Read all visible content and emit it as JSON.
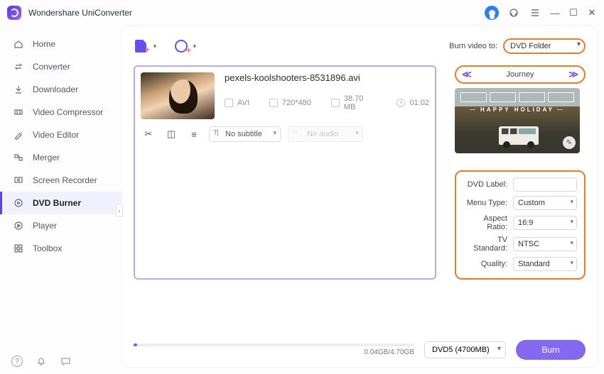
{
  "app": {
    "title": "Wondershare UniConverter"
  },
  "sidebar": {
    "items": [
      {
        "label": "Home"
      },
      {
        "label": "Converter"
      },
      {
        "label": "Downloader"
      },
      {
        "label": "Video Compressor"
      },
      {
        "label": "Video Editor"
      },
      {
        "label": "Merger"
      },
      {
        "label": "Screen Recorder"
      },
      {
        "label": "DVD Burner"
      },
      {
        "label": "Player"
      },
      {
        "label": "Toolbox"
      }
    ],
    "active_index": 7
  },
  "toolbar": {
    "burn_to_label": "Burn video to:",
    "burn_to_value": "DVD Folder"
  },
  "file": {
    "name": "pexels-koolshooters-8531896.avi",
    "format": "AVI",
    "resolution": "720*480",
    "size": "38.70 MB",
    "duration": "01:02",
    "subtitle": "No subtitle",
    "audio": "No audio"
  },
  "template": {
    "name": "Journey",
    "caption": "HAPPY HOLIDAY"
  },
  "settings": {
    "labels": {
      "dvd_label": "DVD Label:",
      "menu_type": "Menu Type:",
      "aspect_ratio": "Aspect Ratio:",
      "tv_standard": "TV Standard:",
      "quality": "Quality:"
    },
    "dvd_label": "",
    "menu_type": "Custom",
    "aspect_ratio": "16:9",
    "tv_standard": "NTSC",
    "quality": "Standard"
  },
  "footer": {
    "progress_text": "0.04GB/4.70GB",
    "disc_size": "DVD5 (4700MB)",
    "burn_label": "Burn"
  }
}
